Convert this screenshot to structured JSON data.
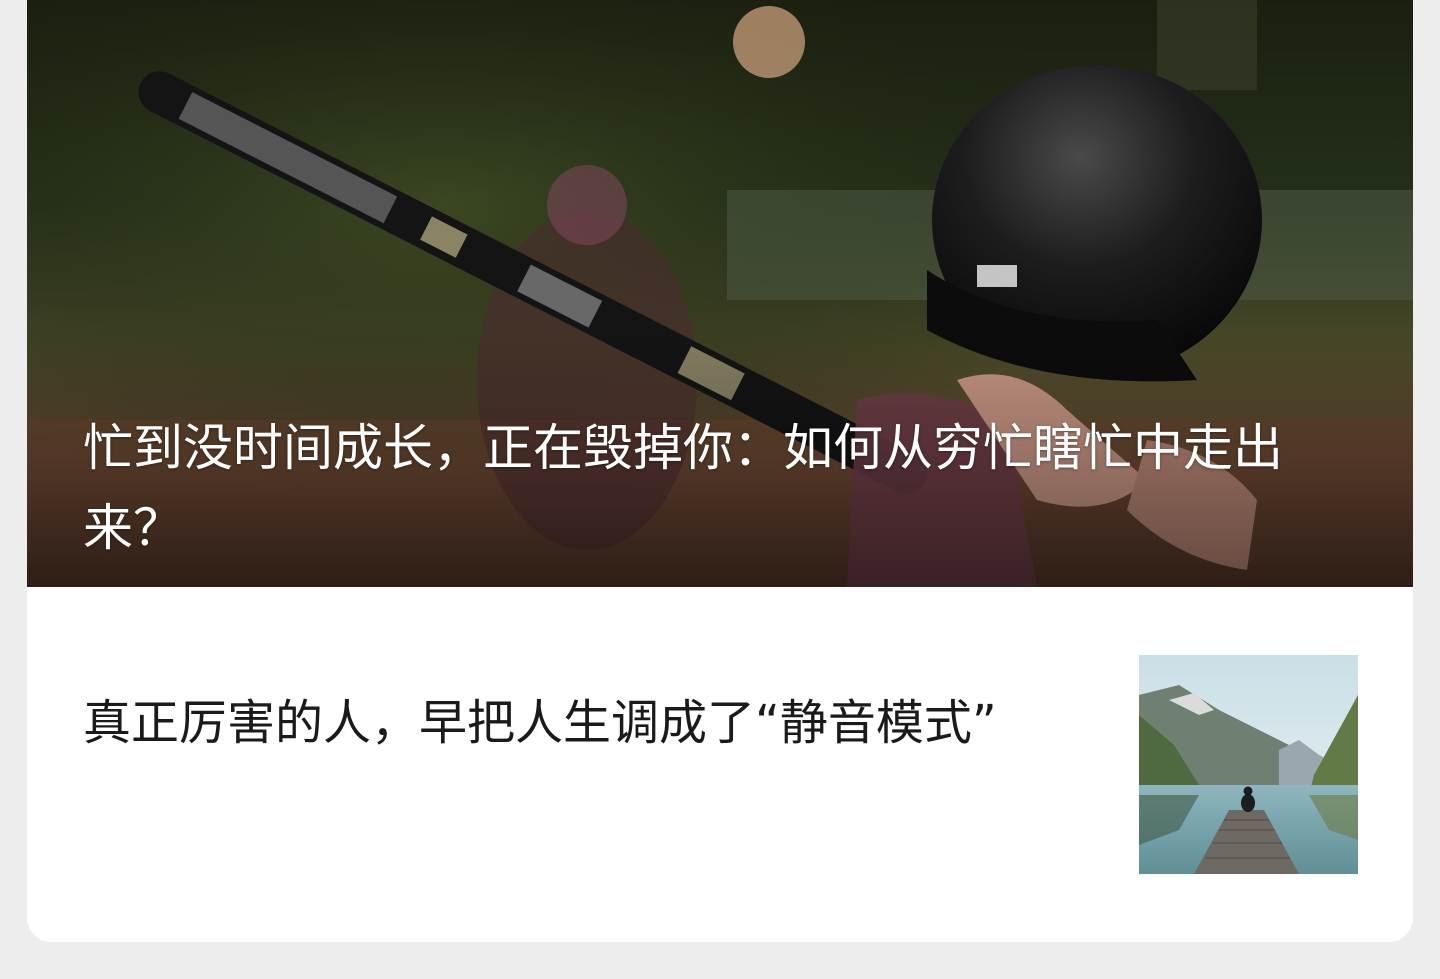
{
  "featured": {
    "title": "忙到没时间成长，正在毁掉你：如何从穷忙瞎忙中走出来？",
    "image": "baseball-batter-photo"
  },
  "articles": [
    {
      "title": "真正厉害的人，早把人生调成了“静音模式”",
      "thumbnail": "mountain-lake-dock-photo"
    }
  ],
  "colors": {
    "page_background": "#ededed",
    "card_background": "#ffffff",
    "featured_title": "#ffffff",
    "article_title": "#1a1a1a"
  }
}
